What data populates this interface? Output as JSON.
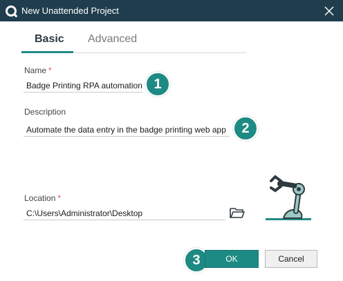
{
  "window": {
    "title": "New Unattended Project",
    "logo_icon": "uipath-logo-icon",
    "close_icon": "close-icon"
  },
  "tabs": [
    {
      "label": "Basic",
      "active": true
    },
    {
      "label": "Advanced",
      "active": false
    }
  ],
  "form": {
    "name": {
      "label": "Name",
      "required_mark": "*",
      "value": "Badge Printing RPA automation"
    },
    "description": {
      "label": "Description",
      "value": "Automate the data entry in the badge printing web app"
    },
    "location": {
      "label": "Location",
      "required_mark": "*",
      "value": "C:\\Users\\Administrator\\Desktop",
      "browse_icon": "folder-icon"
    }
  },
  "callouts": [
    "1",
    "2",
    "3"
  ],
  "illustration_icon": "robot-arm-icon",
  "buttons": {
    "ok": "OK",
    "cancel": "Cancel"
  },
  "colors": {
    "titlebar": "#1f3d4d",
    "accent": "#1e8a84",
    "required": "#d9534f"
  }
}
